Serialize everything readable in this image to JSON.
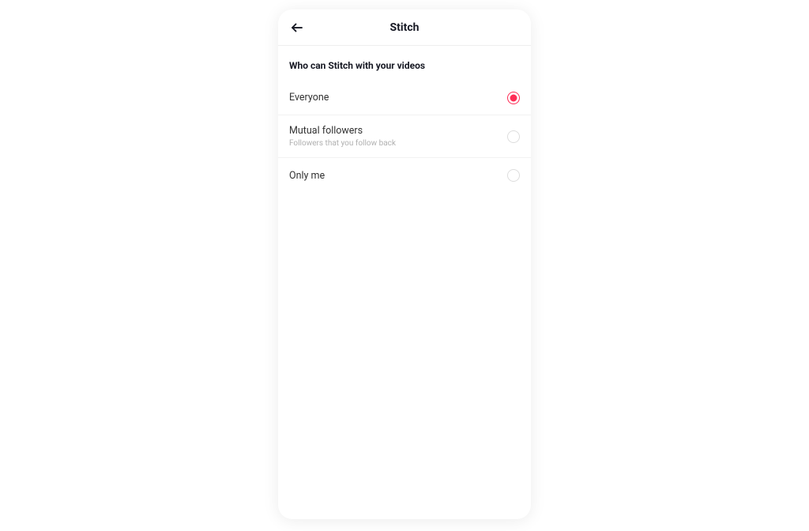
{
  "header": {
    "title": "Stitch"
  },
  "section": {
    "title": "Who can Stitch with your videos"
  },
  "options": [
    {
      "label": "Everyone",
      "sublabel": "",
      "selected": true
    },
    {
      "label": "Mutual followers",
      "sublabel": "Followers that you follow back",
      "selected": false
    },
    {
      "label": "Only me",
      "sublabel": "",
      "selected": false
    }
  ],
  "colors": {
    "accent": "#fe2c55"
  }
}
